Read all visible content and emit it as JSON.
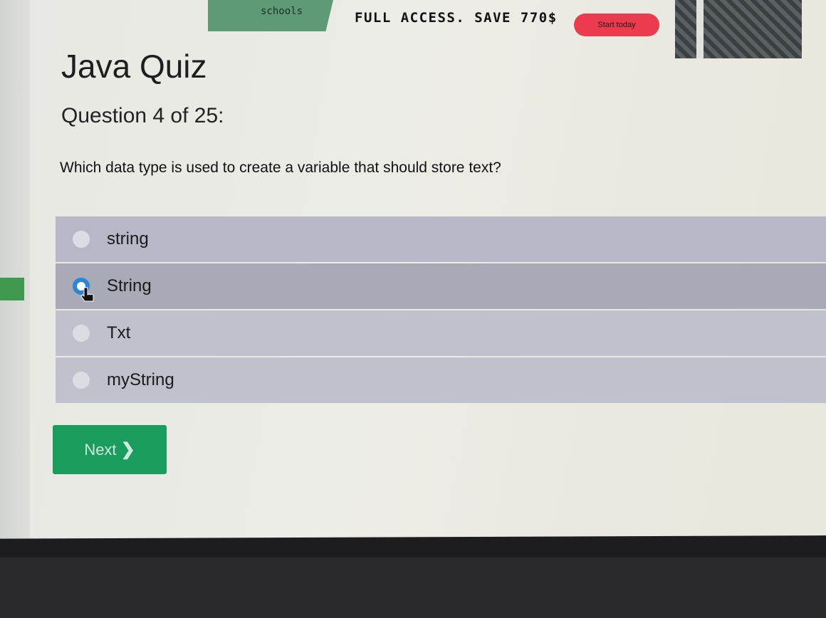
{
  "banner": {
    "brand": "schools",
    "offer": "FULL ACCESS. SAVE 770$",
    "cta": "Start today"
  },
  "quiz": {
    "title": "Java Quiz",
    "counter": "Question 4 of 25:",
    "question": "Which data type is used to create a variable that should store text?",
    "options": [
      {
        "label": "string",
        "selected": false
      },
      {
        "label": "String",
        "selected": true
      },
      {
        "label": "Txt",
        "selected": false
      },
      {
        "label": "myString",
        "selected": false
      }
    ],
    "next_label": "Next"
  },
  "colors": {
    "next_button": "#199c5e",
    "radio_selected": "#2c86d6",
    "banner_cta": "#ec3a4e",
    "banner_green": "#5d9a75"
  }
}
